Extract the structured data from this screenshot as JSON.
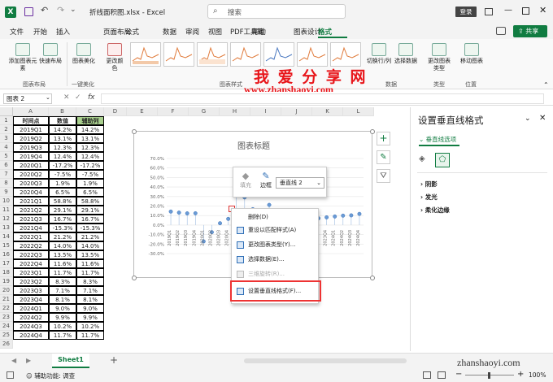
{
  "app": {
    "file_name": "折线面积图.xlsx",
    "app_name": "Excel",
    "search_placeholder": "搜索",
    "login_label": "登录"
  },
  "menu": [
    "文件",
    "开始",
    "插入",
    "页面布局",
    "公式",
    "数据",
    "审阅",
    "视图",
    "PDF工具箱",
    "帮助",
    "图表设计",
    "格式"
  ],
  "share_label": "共享",
  "ribbon": {
    "groups": [
      {
        "label": "图表布局"
      },
      {
        "label": "一键美化"
      },
      {
        "label": "图表样式"
      },
      {
        "label": "数据"
      },
      {
        "label": "类型"
      },
      {
        "label": "位置"
      }
    ],
    "buttons": {
      "add_chart_element": "添加图表元素",
      "quick_layout": "快速布局",
      "chart_beautify": "图表美化",
      "change_colors": "更改颜色",
      "switch_row_col": "切换行/列",
      "select_data": "选择数据",
      "change_chart_type": "更改图表类型",
      "move_chart": "移动图表"
    }
  },
  "watermark": {
    "line1": "我 爱 分 享 网",
    "line2": "www.zhanshaoyi.com",
    "corner": "zhanshaoyi.com"
  },
  "formula_bar": {
    "name_box": "图表 2",
    "fx": "fx"
  },
  "columns": [
    "A",
    "B",
    "C",
    "D",
    "E",
    "F",
    "G",
    "H",
    "I",
    "J",
    "K",
    "L"
  ],
  "table": {
    "headers": [
      "时间点",
      "数值",
      "辅助列"
    ],
    "rows": [
      [
        "2019Q1",
        "14.2%",
        "14.2%"
      ],
      [
        "2019Q2",
        "13.1%",
        "13.1%"
      ],
      [
        "2019Q3",
        "12.3%",
        "12.3%"
      ],
      [
        "2019Q4",
        "12.4%",
        "12.4%"
      ],
      [
        "2020Q1",
        "-17.2%",
        "-17.2%"
      ],
      [
        "2020Q2",
        "-7.5%",
        "-7.5%"
      ],
      [
        "2020Q3",
        "1.9%",
        "1.9%"
      ],
      [
        "2020Q4",
        "6.5%",
        "6.5%"
      ],
      [
        "2021Q1",
        "58.8%",
        "58.8%"
      ],
      [
        "2021Q2",
        "29.1%",
        "29.1%"
      ],
      [
        "2021Q3",
        "16.7%",
        "16.7%"
      ],
      [
        "2021Q4",
        "-15.3%",
        "-15.3%"
      ],
      [
        "2022Q1",
        "21.2%",
        "21.2%"
      ],
      [
        "2022Q2",
        "14.0%",
        "14.0%"
      ],
      [
        "2022Q3",
        "13.5%",
        "13.5%"
      ],
      [
        "2022Q4",
        "11.6%",
        "11.6%"
      ],
      [
        "2023Q1",
        "11.7%",
        "11.7%"
      ],
      [
        "2023Q2",
        "8.3%",
        "8.3%"
      ],
      [
        "2023Q3",
        "7.1%",
        "7.1%"
      ],
      [
        "2023Q4",
        "8.1%",
        "8.1%"
      ],
      [
        "2024Q1",
        "9.0%",
        "9.0%"
      ],
      [
        "2024Q2",
        "9.9%",
        "9.9%"
      ],
      [
        "2024Q3",
        "10.2%",
        "10.2%"
      ],
      [
        "2024Q4",
        "11.7%",
        "11.7%"
      ]
    ]
  },
  "chart_data": {
    "type": "line",
    "title": "图表标题",
    "categories": [
      "2019Q1",
      "2019Q2",
      "2019Q3",
      "2019Q4",
      "2020Q1",
      "2020Q2",
      "2020Q3",
      "2020Q4",
      "2021Q1",
      "2021Q2",
      "2021Q3",
      "2021Q4",
      "2022Q1",
      "2022Q2",
      "2022Q3",
      "2022Q4",
      "2023Q1",
      "2023Q2",
      "2023Q3",
      "2023Q4",
      "2024Q1",
      "2024Q2",
      "2024Q3",
      "2024Q4"
    ],
    "series": [
      {
        "values": [
          14.2,
          13.1,
          12.3,
          12.4,
          -17.2,
          -7.5,
          1.9,
          6.5,
          58.8,
          29.1,
          16.7,
          -15.3,
          21.2,
          14.0,
          13.5,
          11.6,
          11.7,
          8.3,
          7.1,
          8.1,
          9.0,
          9.9,
          10.2,
          11.7
        ]
      }
    ],
    "ylim": [
      -30,
      70
    ],
    "yticks": [
      "70.0%",
      "60.0%",
      "50.0%",
      "40.0%",
      "30.0%",
      "20.0%",
      "10.0%",
      "0.0%",
      "-10.0%",
      "-20.0%",
      "-30.0%"
    ],
    "grid": true
  },
  "mini_toolbar": {
    "fill_label": "填充",
    "border_label": "边框",
    "series_select": "垂直线 2"
  },
  "context_menu": {
    "items": [
      "删除(D)",
      "重设以匹配样式(A)",
      "更改图表类型(Y)...",
      "选择数据(E)...",
      "三维旋转(R)...",
      "设置垂直线格式(F)..."
    ]
  },
  "format_pane": {
    "title": "设置垂直线格式",
    "tab_label": "垂直线选项",
    "sections": [
      "阴影",
      "发光",
      "柔化边缘"
    ]
  },
  "sheet_tab": "Sheet1",
  "status": {
    "accessibility": "辅助功能: 调查",
    "zoom": "100%"
  }
}
